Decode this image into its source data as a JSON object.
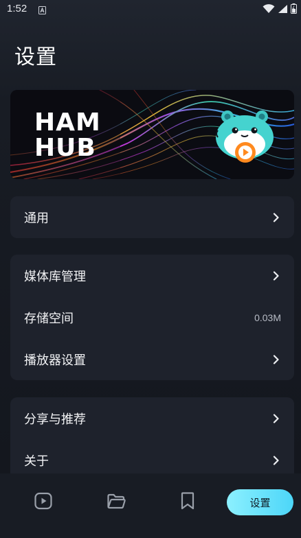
{
  "status_bar": {
    "time": "1:52",
    "icons": [
      "notification-a-icon",
      "wifi-icon",
      "signal-icon",
      "battery-icon"
    ]
  },
  "page": {
    "title": "设置"
  },
  "banner": {
    "logo_line1": "HAM",
    "logo_line2": "HUB",
    "mascot": "hamster-mascot-icon"
  },
  "settings_groups": [
    {
      "items": [
        {
          "label": "通用",
          "value": "",
          "icon": "chevron-right-icon"
        }
      ]
    },
    {
      "items": [
        {
          "label": "媒体库管理",
          "value": "",
          "icon": "chevron-right-icon"
        },
        {
          "label": "存储空间",
          "value": "0.03M",
          "icon": ""
        },
        {
          "label": "播放器设置",
          "value": "",
          "icon": "chevron-right-icon"
        }
      ]
    },
    {
      "items": [
        {
          "label": "分享与推荐",
          "value": "",
          "icon": "chevron-right-icon"
        },
        {
          "label": "关于",
          "value": "",
          "icon": "chevron-right-icon"
        }
      ]
    }
  ],
  "bottom_nav": {
    "items": [
      {
        "icon": "play-icon",
        "active": false
      },
      {
        "icon": "folder-icon",
        "active": false
      },
      {
        "icon": "bookmark-icon",
        "active": false
      }
    ],
    "active_label": "设置"
  },
  "colors": {
    "background": "#181c24",
    "card": "#1e222c",
    "accent": "#4cd6f8",
    "text": "#f2f3f5",
    "muted": "#b8bcc6"
  }
}
